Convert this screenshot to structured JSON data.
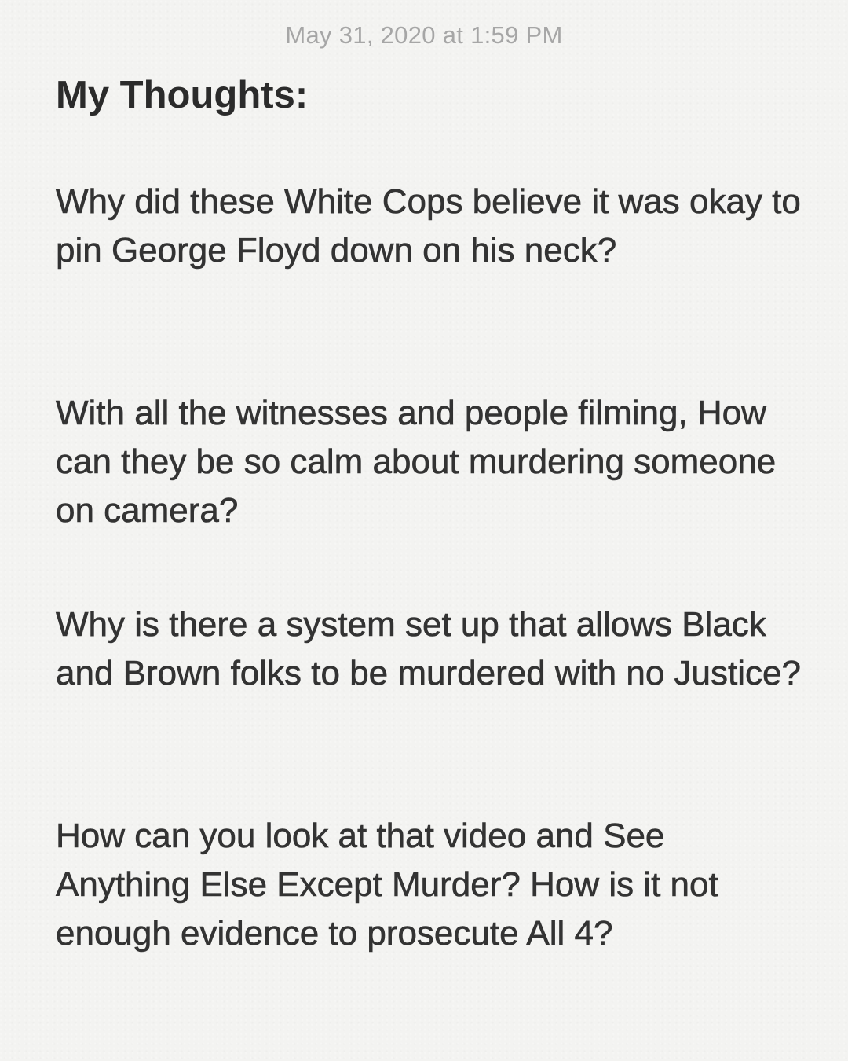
{
  "note": {
    "timestamp": "May 31, 2020 at 1:59 PM",
    "title": "My Thoughts:",
    "paragraphs": [
      "Why did these White Cops believe it was okay to pin George Floyd down on his neck?",
      "With all the witnesses and people filming, How can they be so calm about murdering someone on camera?",
      "Why is there a system set up that allows Black and Brown folks to be murdered with no Justice?",
      "How can you look at that video and See Anything Else Except Murder? How is it not enough evidence to prosecute All 4?"
    ]
  }
}
